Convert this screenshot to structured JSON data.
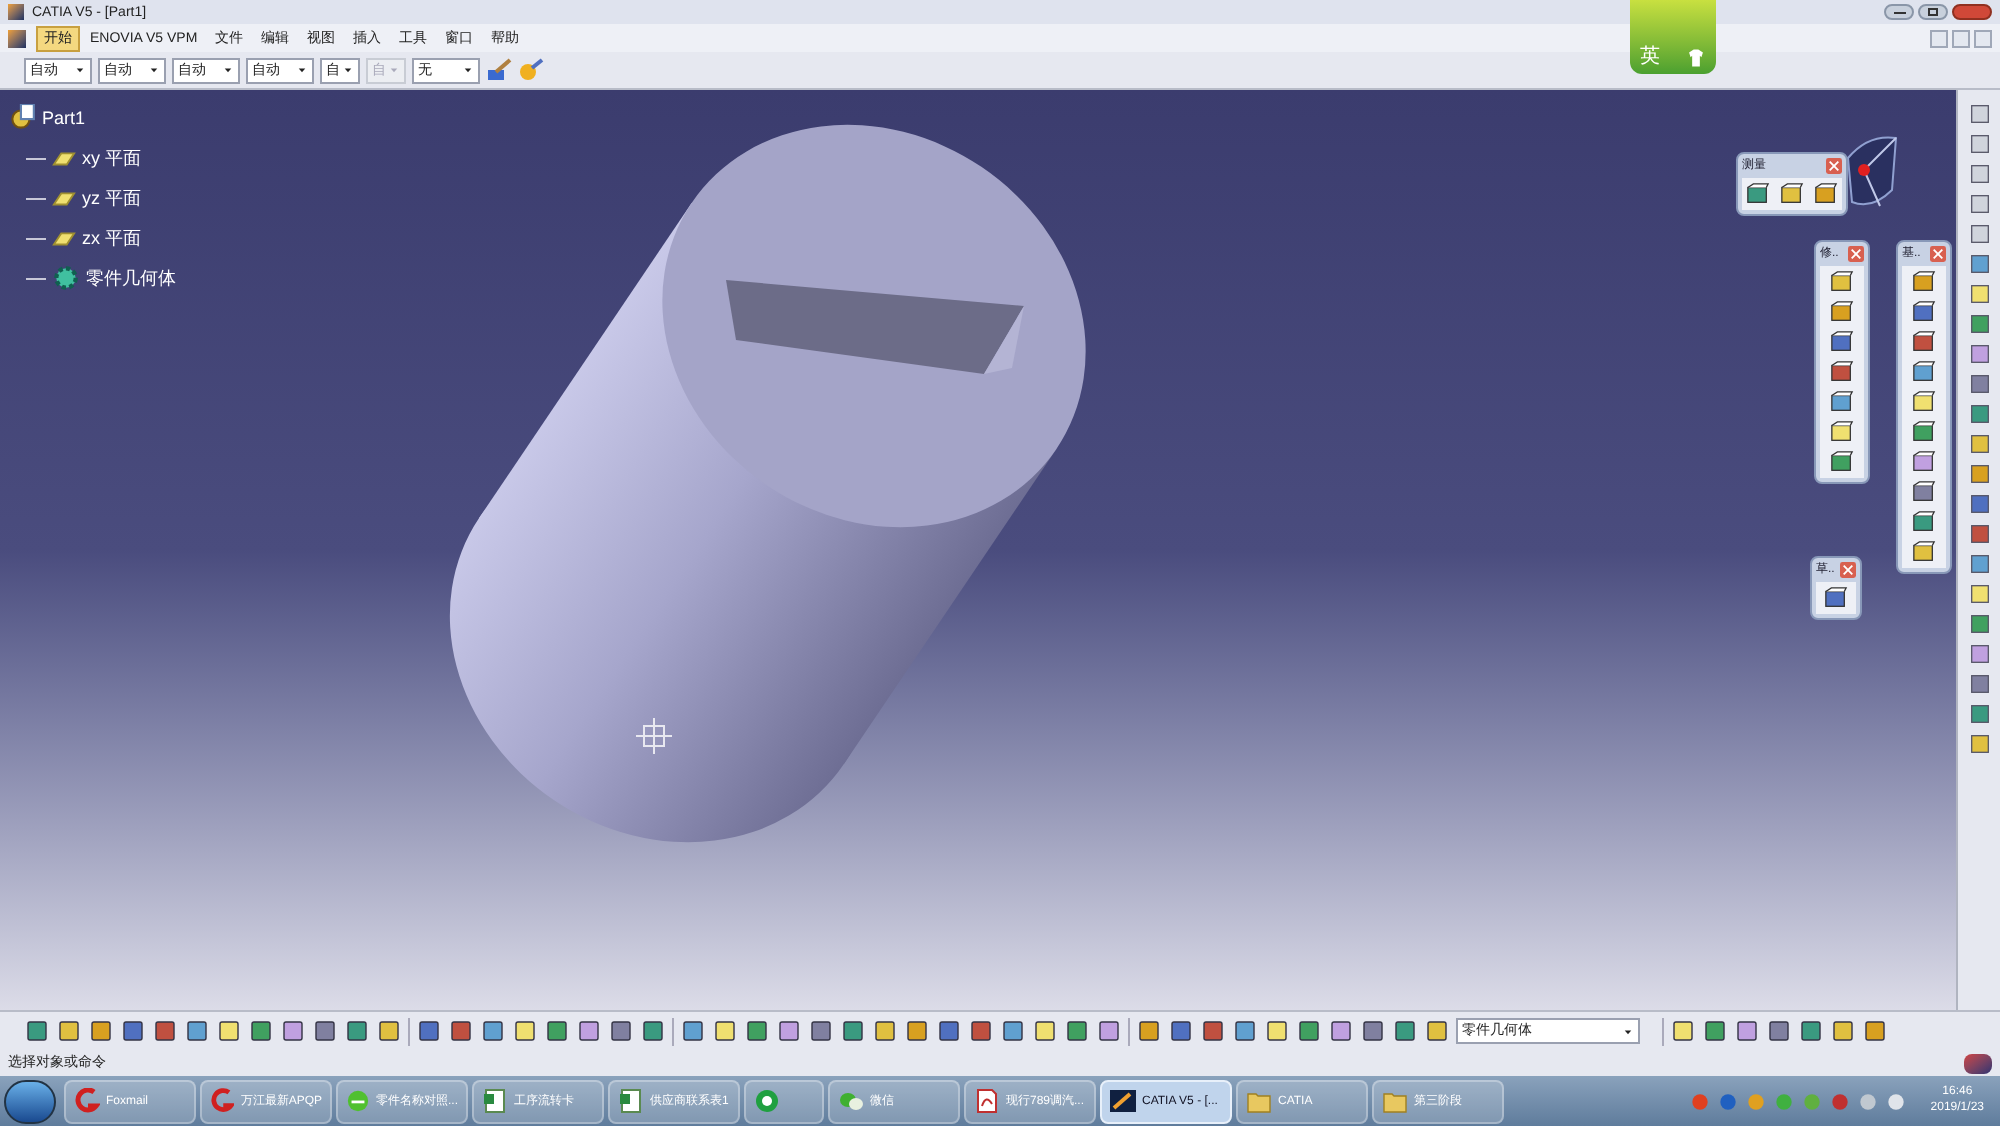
{
  "window": {
    "title": "CATIA V5 - [Part1]"
  },
  "menu": [
    {
      "label": "开始",
      "selected": true
    },
    {
      "label": "ENOVIA V5 VPM",
      "selected": false
    },
    {
      "label": "文件",
      "selected": false
    },
    {
      "label": "编辑",
      "selected": false
    },
    {
      "label": "视图",
      "selected": false
    },
    {
      "label": "插入",
      "selected": false
    },
    {
      "label": "工具",
      "selected": false
    },
    {
      "label": "窗口",
      "selected": false
    },
    {
      "label": "帮助",
      "selected": false
    }
  ],
  "properties_toolbar": [
    {
      "value": "自动",
      "disabled": false
    },
    {
      "value": "自动",
      "disabled": false
    },
    {
      "value": "自动",
      "disabled": false
    },
    {
      "value": "自动",
      "disabled": false
    },
    {
      "value": "自",
      "disabled": false
    },
    {
      "value": "自",
      "disabled": true
    },
    {
      "value": "无",
      "disabled": false
    }
  ],
  "ime": {
    "label": "英"
  },
  "tree": {
    "label": "Part1",
    "children": [
      {
        "label": "xy 平面",
        "kind": "plane"
      },
      {
        "label": "yz 平面",
        "kind": "plane"
      },
      {
        "label": "zx 平面",
        "kind": "plane"
      },
      {
        "label": "零件几何体",
        "kind": "body"
      }
    ]
  },
  "floating_toolbars": [
    {
      "title": "测量"
    },
    {
      "title": "修.."
    },
    {
      "title": "基.."
    },
    {
      "title": "草.."
    }
  ],
  "bottom_toolbar": {
    "current_body": "零件几何体"
  },
  "status_bar": {
    "prompt": "选择对象或命令"
  },
  "taskbar": {
    "items": [
      {
        "label": "Foxmail",
        "kind": "mail",
        "selected": false
      },
      {
        "label": "万江最新APQP",
        "kind": "mail",
        "selected": false
      },
      {
        "label": "零件名称对照...",
        "kind": "browser",
        "selected": false
      },
      {
        "label": "工序流转卡",
        "kind": "sheet",
        "selected": false
      },
      {
        "label": "供应商联系表1",
        "kind": "sheet",
        "selected": false
      },
      {
        "kind": "app",
        "selected": false
      },
      {
        "label": "微信",
        "kind": "chat",
        "selected": false
      },
      {
        "label": "现行789调汽...",
        "kind": "pdf",
        "selected": false
      },
      {
        "label": "CATIA V5 - [...",
        "kind": "catia",
        "selected": true
      },
      {
        "label": "CATIA",
        "kind": "folder",
        "selected": false
      },
      {
        "label": "第三阶段",
        "kind": "folder",
        "selected": false
      }
    ],
    "time": "16:46",
    "date": "2019/1/23"
  }
}
